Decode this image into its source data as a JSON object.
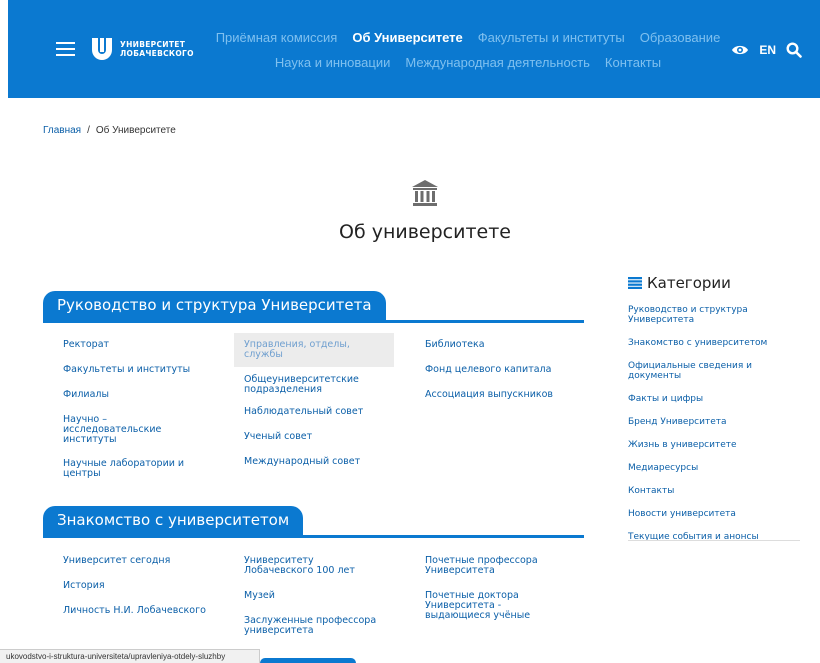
{
  "header": {
    "logo": {
      "line1": "УНИВЕРСИТЕТ",
      "line2": "ЛОБАЧЕВСКОГО"
    },
    "nav_row1": [
      "Приёмная комиссия",
      "Об Университете",
      "Факультеты и институты",
      "Образование"
    ],
    "nav_row2": [
      "Наука и инновации",
      "Международная деятельность",
      "Контакты"
    ],
    "active_nav": "Об Университете",
    "lang": "EN",
    "colors": {
      "brand": "#0b79d0",
      "nav_inactive": "#7fc0ef"
    }
  },
  "breadcrumb": {
    "home": "Главная",
    "separator": "/",
    "current": "Об Университете"
  },
  "page": {
    "title": "Об университете",
    "icon": "university-building-icon"
  },
  "sections": [
    {
      "title": "Руководство и структура Университета",
      "columns": [
        [
          "Ректорат",
          "Факультеты и институты",
          "Филиалы",
          "Научно – исследовательские институты",
          "Научные лаборатории и центры"
        ],
        [
          "Управления, отделы, службы",
          "Общеуниверситетские подразделения",
          "Наблюдательный совет",
          "Ученый совет",
          "Международный совет"
        ],
        [
          "Библиотека",
          "Фонд целевого капитала",
          "Ассоциация выпускников"
        ]
      ]
    },
    {
      "title": "Знакомство с университетом",
      "columns": [
        [
          "Университет сегодня",
          "История",
          "Личность Н.И. Лобачевского"
        ],
        [
          "Университету Лобачевского 100 лет",
          "Музей",
          "Заслуженные профессора университета"
        ],
        [
          "Почетные профессора Университета",
          "Почетные доктора Университета - выдающиеся учёные"
        ]
      ]
    }
  ],
  "sidebar": {
    "title": "Категории",
    "icon": "list-icon",
    "items": [
      "Руководство и структура Университета",
      "Знакомство с университетом",
      "Официальные сведения и документы",
      "Факты и цифры",
      "Бренд Университета",
      "Жизнь в университете",
      "Медиаресурсы",
      "Контакты",
      "Новости университета",
      "Текущие события и анонсы"
    ]
  },
  "status_url": "ukovodstvo-i-struktura-universiteta/upravleniya-otdely-sluzhby"
}
